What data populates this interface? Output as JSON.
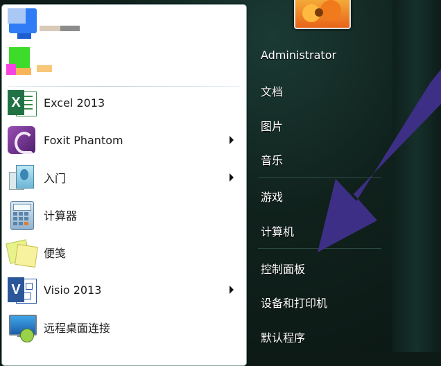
{
  "left_menu": {
    "items": [
      {
        "label": "",
        "icon": "blurred-app-icon-1"
      },
      {
        "label": "",
        "icon": "blurred-app-icon-2"
      },
      {
        "label": "Excel 2013",
        "icon": "excel-icon",
        "has_submenu": false
      },
      {
        "label": "Foxit Phantom",
        "icon": "foxit-icon",
        "has_submenu": true
      },
      {
        "label": "入门",
        "icon": "getting-started-icon",
        "has_submenu": true
      },
      {
        "label": "计算器",
        "icon": "calculator-icon",
        "has_submenu": false
      },
      {
        "label": "便笺",
        "icon": "sticky-notes-icon",
        "has_submenu": false
      },
      {
        "label": "Visio 2013",
        "icon": "visio-icon",
        "has_submenu": true
      },
      {
        "label": "远程桌面连接",
        "icon": "remote-desktop-icon",
        "has_submenu": false
      }
    ]
  },
  "right_menu": {
    "user": "Administrator",
    "items": [
      "文档",
      "图片",
      "音乐",
      "游戏",
      "计算机",
      "控制面板",
      "设备和打印机",
      "默认程序"
    ]
  },
  "colors": {
    "arrow": "#3d2f86",
    "panel_bg": "#ffffff",
    "glass_bg": "#10211c"
  }
}
